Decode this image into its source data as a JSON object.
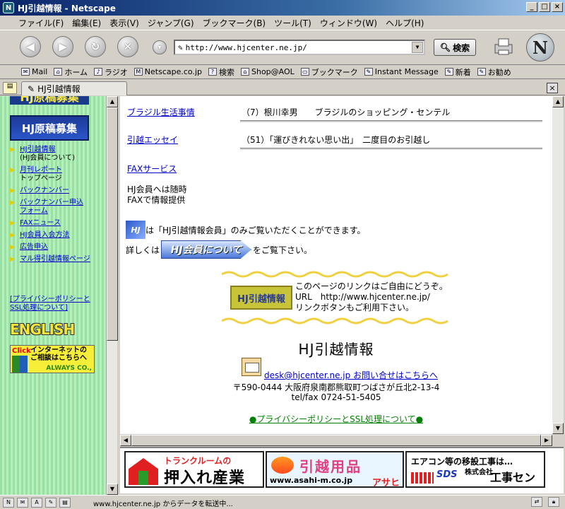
{
  "window": {
    "title": "HJ引越情報 - Netscape",
    "controls": [
      "_",
      "□",
      "×"
    ]
  },
  "menu": [
    "ファイル(F)",
    "編集(E)",
    "表示(V)",
    "ジャンプ(G)",
    "ブックマーク(B)",
    "ツール(T)",
    "ウィンドウ(W)",
    "ヘルプ(H)"
  ],
  "nav": {
    "url": "http://www.hjcenter.ne.jp/",
    "search_label": "検索",
    "logo": "N"
  },
  "personal_toolbar": [
    "Mail",
    "ホーム",
    "ラジオ",
    "Netscape.co.jp",
    "検索",
    "Shop@AOL",
    "ブックマーク",
    "Instant Message",
    "新着",
    "お勧め"
  ],
  "tab": {
    "label": "HJ引越情報",
    "close": "×"
  },
  "left": {
    "top_banner": "HJ原稿募集",
    "recruit": "HJ原稿募集",
    "links": [
      {
        "label": "HJ引越情報",
        "sub": "(HJ会員について)"
      },
      {
        "label": "月刊レポート",
        "sub": "トップページ"
      },
      {
        "label": "バックナンバー",
        "sub": ""
      },
      {
        "label": "バックナンバー申込",
        "label2": "フォーム",
        "sub": ""
      },
      {
        "label": "FAXニュース",
        "sub": ""
      },
      {
        "label": "HJ会員入会方法",
        "sub": ""
      },
      {
        "label": "広告申込",
        "sub": ""
      },
      {
        "label": "マル得引越情報ページ",
        "sub": ""
      }
    ],
    "privacy_1": "[プライバシーポリシーと",
    "privacy_2": "SSL処理について]",
    "english": "ENGLISH",
    "click_ad": {
      "click": "Click",
      "line1": "インターネットの",
      "line2": "ご相談はこちらへ",
      "company": "ALWAYS CO.,"
    }
  },
  "main": {
    "rows": [
      {
        "link": "ブラジル生活事情",
        "desc": "（7）根川幸男　　ブラジルのショッピング・センテル"
      },
      {
        "link": "引越エッセイ",
        "desc": "（51）「運びきれない思い出」　二度目のお引越し"
      },
      {
        "link": "FAXサービス",
        "desc": ""
      }
    ],
    "fax_note_1": "HJ会員へは随時",
    "fax_note_2": "FAXで情報提供",
    "hj_badge": "HJ",
    "member_note": "は「HJ引越情報会員」のみご覧いただくことができます。",
    "detail_prefix": "詳しくは",
    "detail_button": "HJ会員について",
    "detail_suffix": "をご覧下さい。",
    "link_banner": "HJ引越情報",
    "link_text_1": "このページのリンクはご自由にどうぞ。",
    "link_text_2": "URL　http://www.hjcenter.ne.jp/",
    "link_text_3": "リンクボタンもご利用下さい。",
    "title": "HJ引越情報",
    "email": "desk@hjcenter.ne.jp お問い合せはこちらへ",
    "address": "〒590-0444 大阪府泉南郡熊取町つばさが丘北2-13-4",
    "tel": "tel/fax 0724-51-5405",
    "privacy_link": "●プライバシーポリシーとSSL処理について●"
  },
  "ads": [
    {
      "line1": "トランクルームの",
      "line2": "押入れ産業"
    },
    {
      "line1": "引越用品",
      "url": "www.asahi-m.co.jp",
      "name": "アサヒ"
    },
    {
      "line1": "エアコン等の移設工事は…",
      "brand": "SDS",
      "kind": "株式会社",
      "name": "工事センター"
    }
  ],
  "status": {
    "text": "www.hjcenter.ne.jp からデータを転送中..."
  },
  "colors": {
    "link": "#0000cc",
    "title_bar": "#0a246a",
    "sidebar_green": "#9ae0a4",
    "wave": "#f0d040"
  }
}
